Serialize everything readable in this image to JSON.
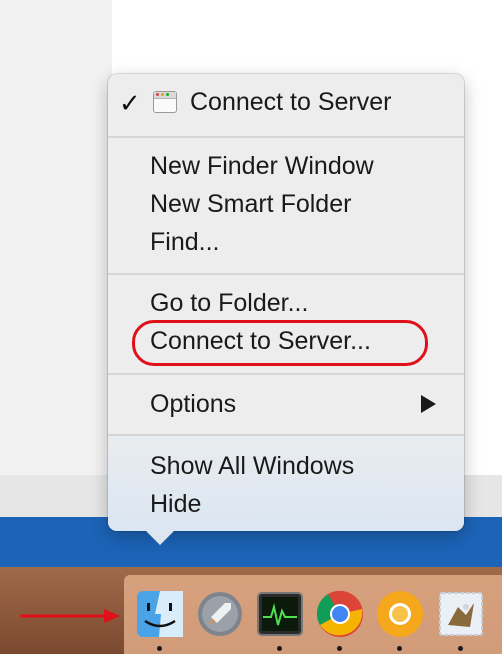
{
  "menu": {
    "header_title": "Connect to Server",
    "items_group1": [
      "New Finder Window",
      "New Smart Folder",
      "Find..."
    ],
    "items_group2": [
      "Go to Folder...",
      "Connect to Server..."
    ],
    "options_label": "Options",
    "items_group4": [
      "Show All Windows",
      "Hide"
    ]
  },
  "dock": {
    "apps": [
      "finder-icon",
      "launchpad-icon",
      "activity-monitor-icon",
      "chrome-icon",
      "chrome-canary-icon",
      "mail-icon"
    ]
  },
  "colors": {
    "highlight": "#e0101a",
    "desktop_blue": "#1c64b8"
  }
}
